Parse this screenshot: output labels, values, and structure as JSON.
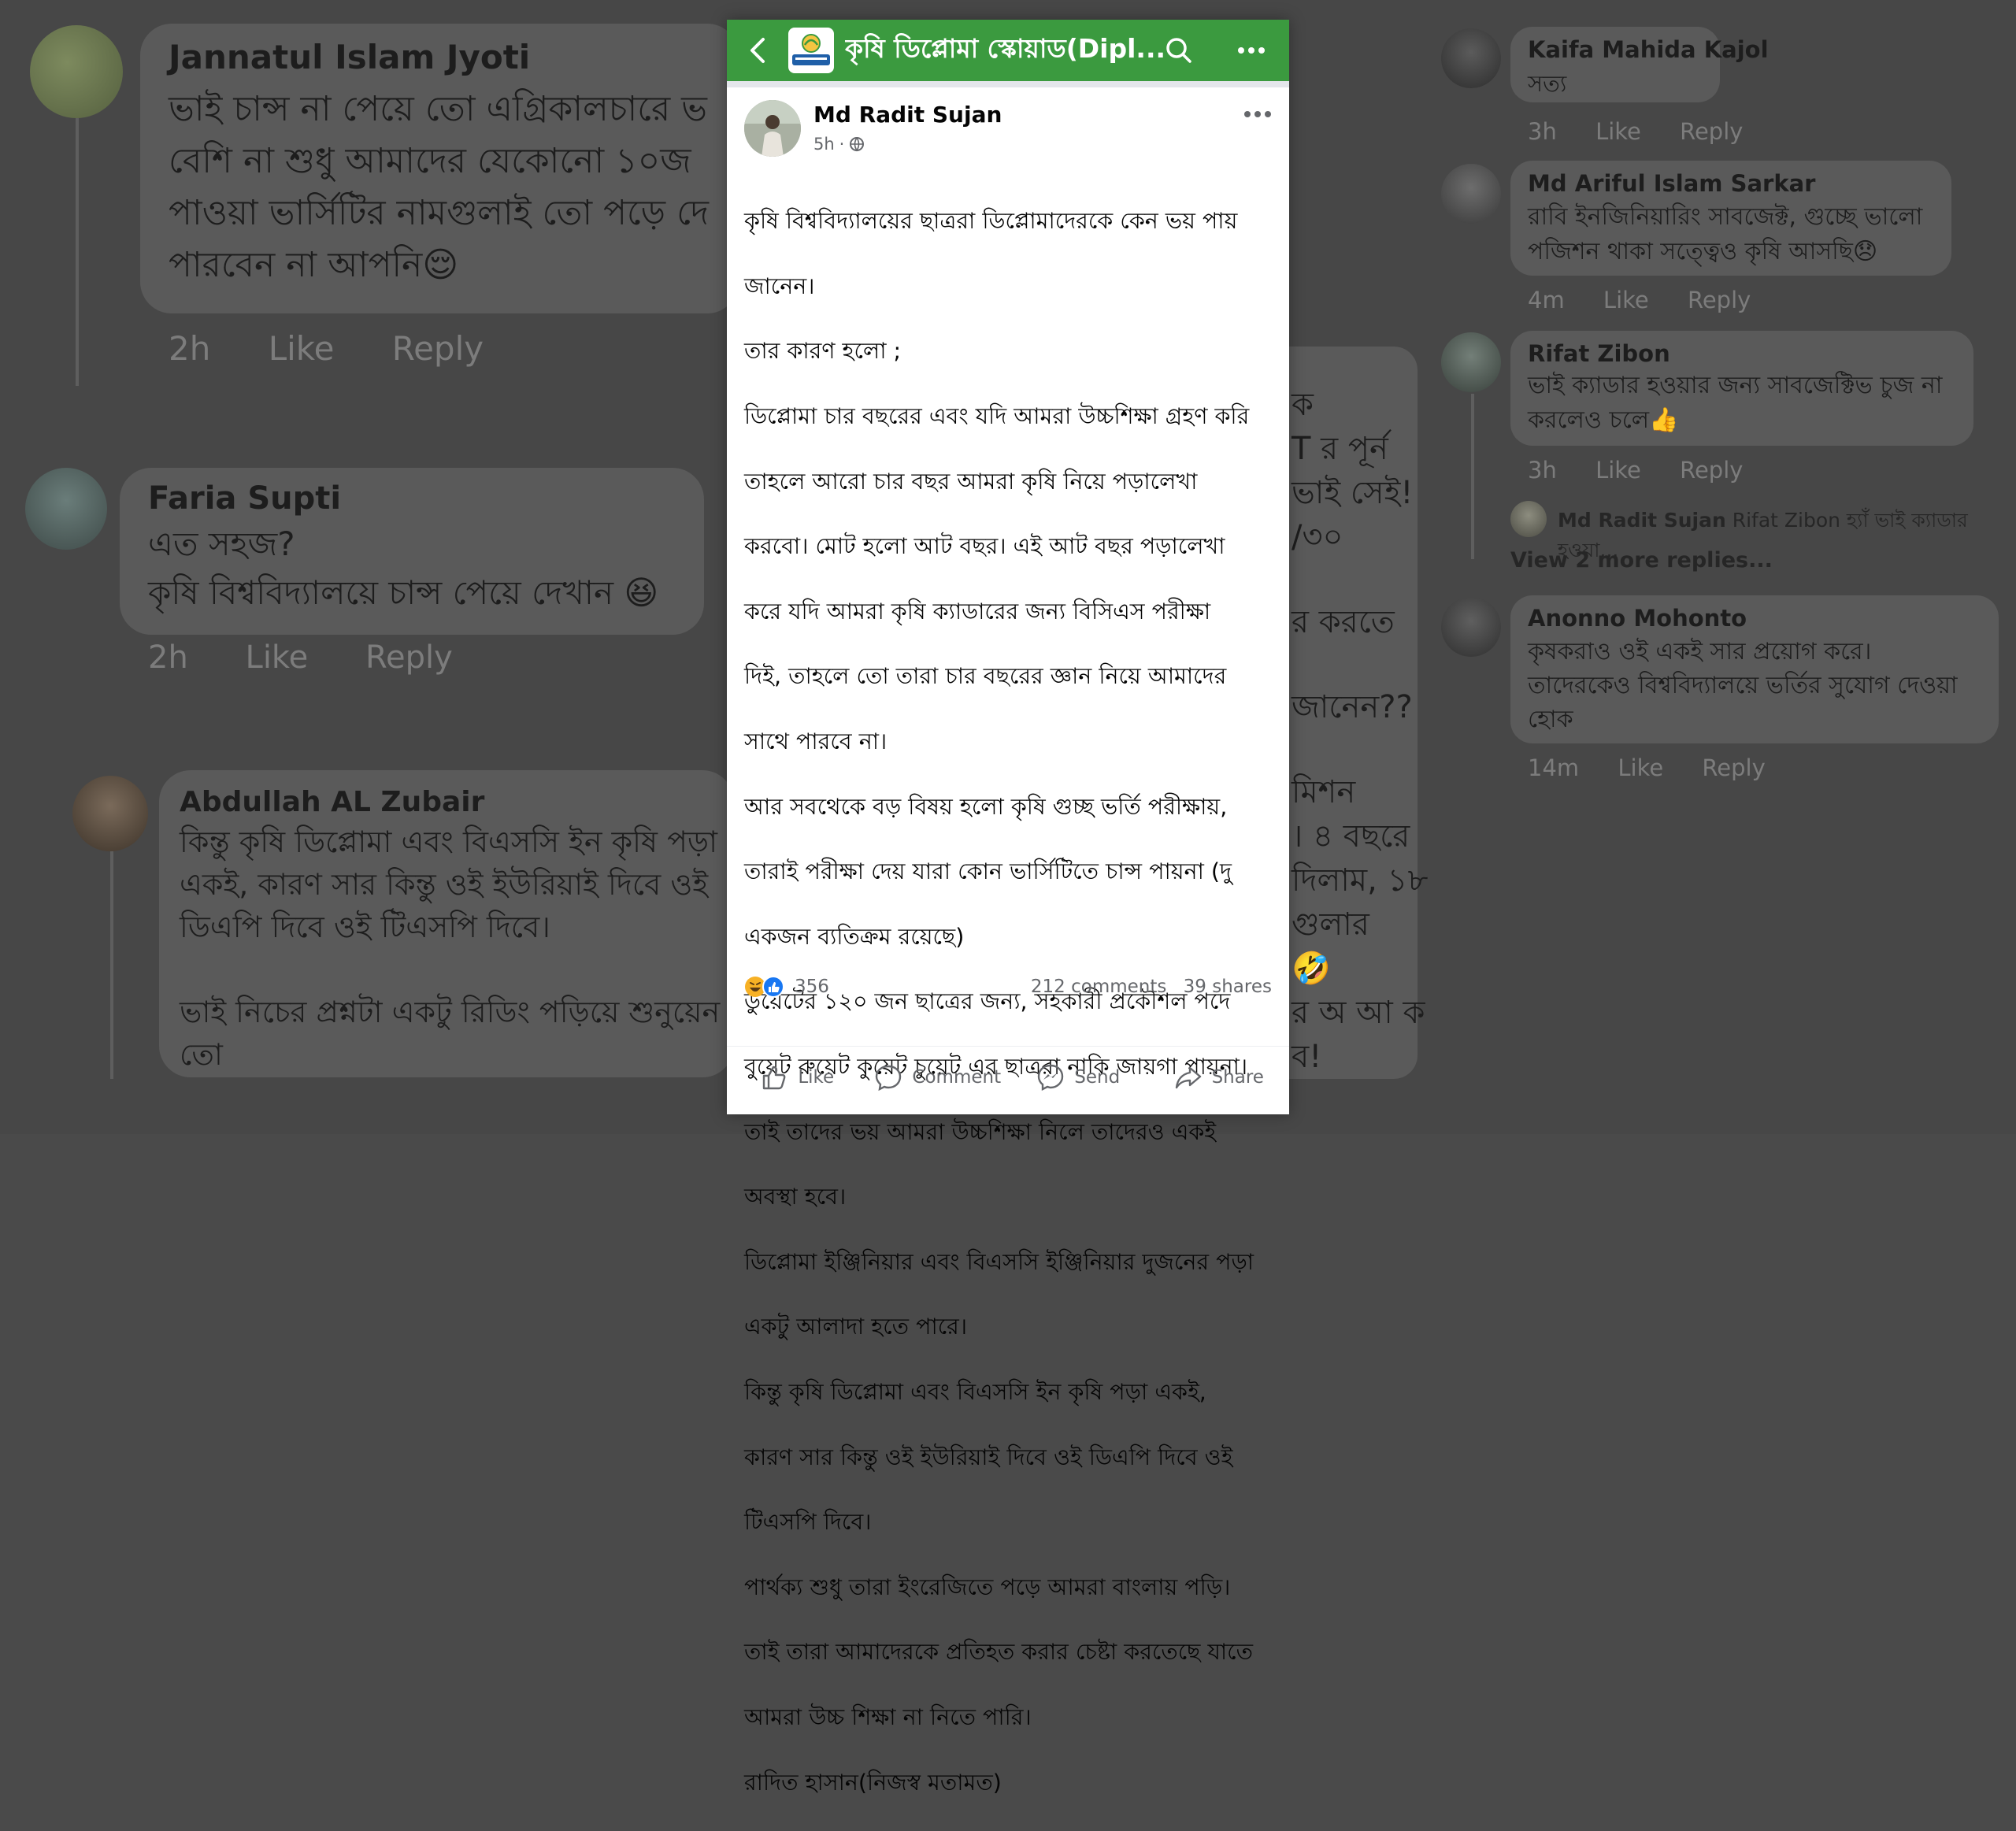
{
  "background": {
    "left_comments": [
      {
        "name": "Jannatul Islam Jyoti",
        "text_lines": [
          "ভাই চান্স না পেয়ে তো এগ্রিকালচারে ভ",
          "বেশি না শুধু  আমাদের যেকোনো ১০জ",
          "পাওয়া ভার্সিটির নামগুলাই তো পড়ে দে",
          "পারবেন না আপনি😌"
        ],
        "time": "2h",
        "like": "Like",
        "reply": "Reply"
      },
      {
        "name": "Faria Supti",
        "text_lines": [
          "এত সহজ?",
          "কৃষি বিশ্ববিদ্যালয়ে চান্স পেয়ে দেখান 😆"
        ],
        "time": "2h",
        "like": "Like",
        "reply": "Reply"
      },
      {
        "name": "Abdullah AL Zubair",
        "text_lines": [
          "কিন্তু কৃষি ডিপ্লোমা এবং বিএসসি ইন কৃষি পড়া",
          "একই, কারণ সার কিন্তু ওই ইউরিয়াই দিবে ওই",
          "ডিএপি দিবে ওই টিএসপি দিবে।",
          "",
          "ভাই নিচের প্রশ্নটা একটু রিডিং পড়িয়ে শুনুয়েন",
          "তো"
        ]
      }
    ],
    "middle_fragments": [
      "ক",
      "T র পূর্ন",
      "ভাই সেই!",
      "/৩০",
      "র করতে",
      "জানেন??",
      "মিশন",
      "।  ৪ বছরে",
      "দিলাম, ১৮",
      "গুলার",
      "🤣",
      "র অ আ ক",
      "ব!"
    ],
    "right_comments": [
      {
        "name": "Kaifa Mahida Kajol",
        "text_lines": [
          "সত্য"
        ],
        "time": "3h",
        "like": "Like",
        "reply": "Reply"
      },
      {
        "name": "Md Ariful Islam Sarkar",
        "text_lines": [
          "রাবি ইনজিনিয়ারিং সাবজেক্ট, গুচ্ছে ভালো",
          "পজিশন থাকা সত্ত্বেও কৃষি আসছি😞"
        ],
        "time": "4m",
        "like": "Like",
        "reply": "Reply"
      },
      {
        "name": "Rifat Zibon",
        "text_lines": [
          "ভাই ক্যাডার হওয়ার জন্য সাবজেক্টিভ চুজ না",
          "করলেও চলে👍"
        ],
        "time": "3h",
        "like": "Like",
        "reply": "Reply"
      },
      {
        "name": "Anonno Mohonto",
        "text_lines": [
          "কৃষকরাও ওই একই সার প্রয়োগ করে।",
          "তাদেরকেও বিশ্ববিদ্যালয়ে ভর্তির সুযোগ দেওয়া",
          "হোক"
        ],
        "time": "14m",
        "like": "Like",
        "reply": "Reply"
      }
    ],
    "reply_preview": {
      "name": "Md Radit Sujan",
      "text": "Rifat Zibon হ্যাঁ ভাই ক্যাডার হওয়া..."
    },
    "view_more": "View 2 more replies..."
  },
  "topbar": {
    "group_title": "কৃষি ডিপ্লোমা স্কোয়াড(Dipl...",
    "icons": {
      "back": "back-arrow-icon",
      "search": "search-icon",
      "more": "more-options-icon"
    }
  },
  "post": {
    "author": "Md Radit Sujan",
    "time": "5h",
    "privacy_icon": "globe-icon",
    "body_lines": [
      "কৃষি বিশ্ববিদ্যালয়ের ছাত্ররা ডিপ্লোমাদেরকে কেন ভয় পায়",
      "জানেন।",
      "তার কারণ হলো ;",
      "ডিপ্লোমা চার বছরের এবং যদি আমরা উচ্চশিক্ষা গ্রহণ করি",
      "তাহলে আরো চার বছর আমরা কৃষি নিয়ে পড়ালেখা",
      "করবো। মোট হলো আট বছর। এই আট বছর পড়ালেখা",
      "করে যদি আমরা কৃষি  ক্যাডারের জন্য বিসিএস পরীক্ষা",
      "দিই, তাহলে তো তারা চার বছরের জ্ঞান নিয়ে আমাদের",
      "সাথে পারবে না।",
      "আর সবথেকে বড় বিষয় হলো কৃষি গুচ্ছ ভর্তি পরীক্ষায়,",
      "তারাই পরীক্ষা দেয় যারা কোন ভার্সিটিতে চান্স পায়না (দু",
      "একজন ব্যতিক্রম রয়েছে)",
      "ডুয়েটের ১২০ জন ছাত্রের জন্য, সহকারী প্রকৌশল পদে",
      "বুয়েট রুয়েট কুয়েট চুয়েট এর ছাত্ররা নাকি জায়গা পায়না।",
      "তাই তাদের ভয় আমরা উচ্চশিক্ষা নিলে তাদেরও একই",
      "অবস্থা হবে।",
      "ডিপ্লোমা ইঞ্জিনিয়ার এবং বিএসসি ইঞ্জিনিয়ার দুজনের পড়া",
      "একটু আলাদা হতে পারে।",
      "কিন্তু কৃষি ডিপ্লোমা এবং বিএসসি ইন কৃষি পড়া একই,",
      "কারণ সার কিন্তু ওই ইউরিয়াই দিবে ওই ডিএপি দিবে ওই",
      "টিএসপি দিবে।",
      "পার্থক্য শুধু তারা ইংরেজিতে পড়ে আমরা বাংলায় পড়ি।",
      "তাই তারা আমাদেরকে প্রতিহত করার চেষ্টা করতেছে যাতে",
      "আমরা উচ্চ শিক্ষা না নিতে পারি।",
      "রাদিত হাসান(নিজস্ব মতামত)"
    ],
    "reactions": {
      "icons": [
        "haha-icon",
        "like-icon"
      ],
      "count": "356"
    },
    "comments": "212 comments",
    "shares": "39 shares",
    "actions": [
      {
        "label": "Like",
        "icon": "thumbs-up-icon"
      },
      {
        "label": "Comment",
        "icon": "comment-icon"
      },
      {
        "label": "Send",
        "icon": "messenger-icon"
      },
      {
        "label": "Share",
        "icon": "share-icon"
      }
    ]
  },
  "colors": {
    "brand_green": "#3b9a3f",
    "like_blue": "#1877f2",
    "haha_yellow": "#f7b125",
    "muted": "#65676b"
  }
}
